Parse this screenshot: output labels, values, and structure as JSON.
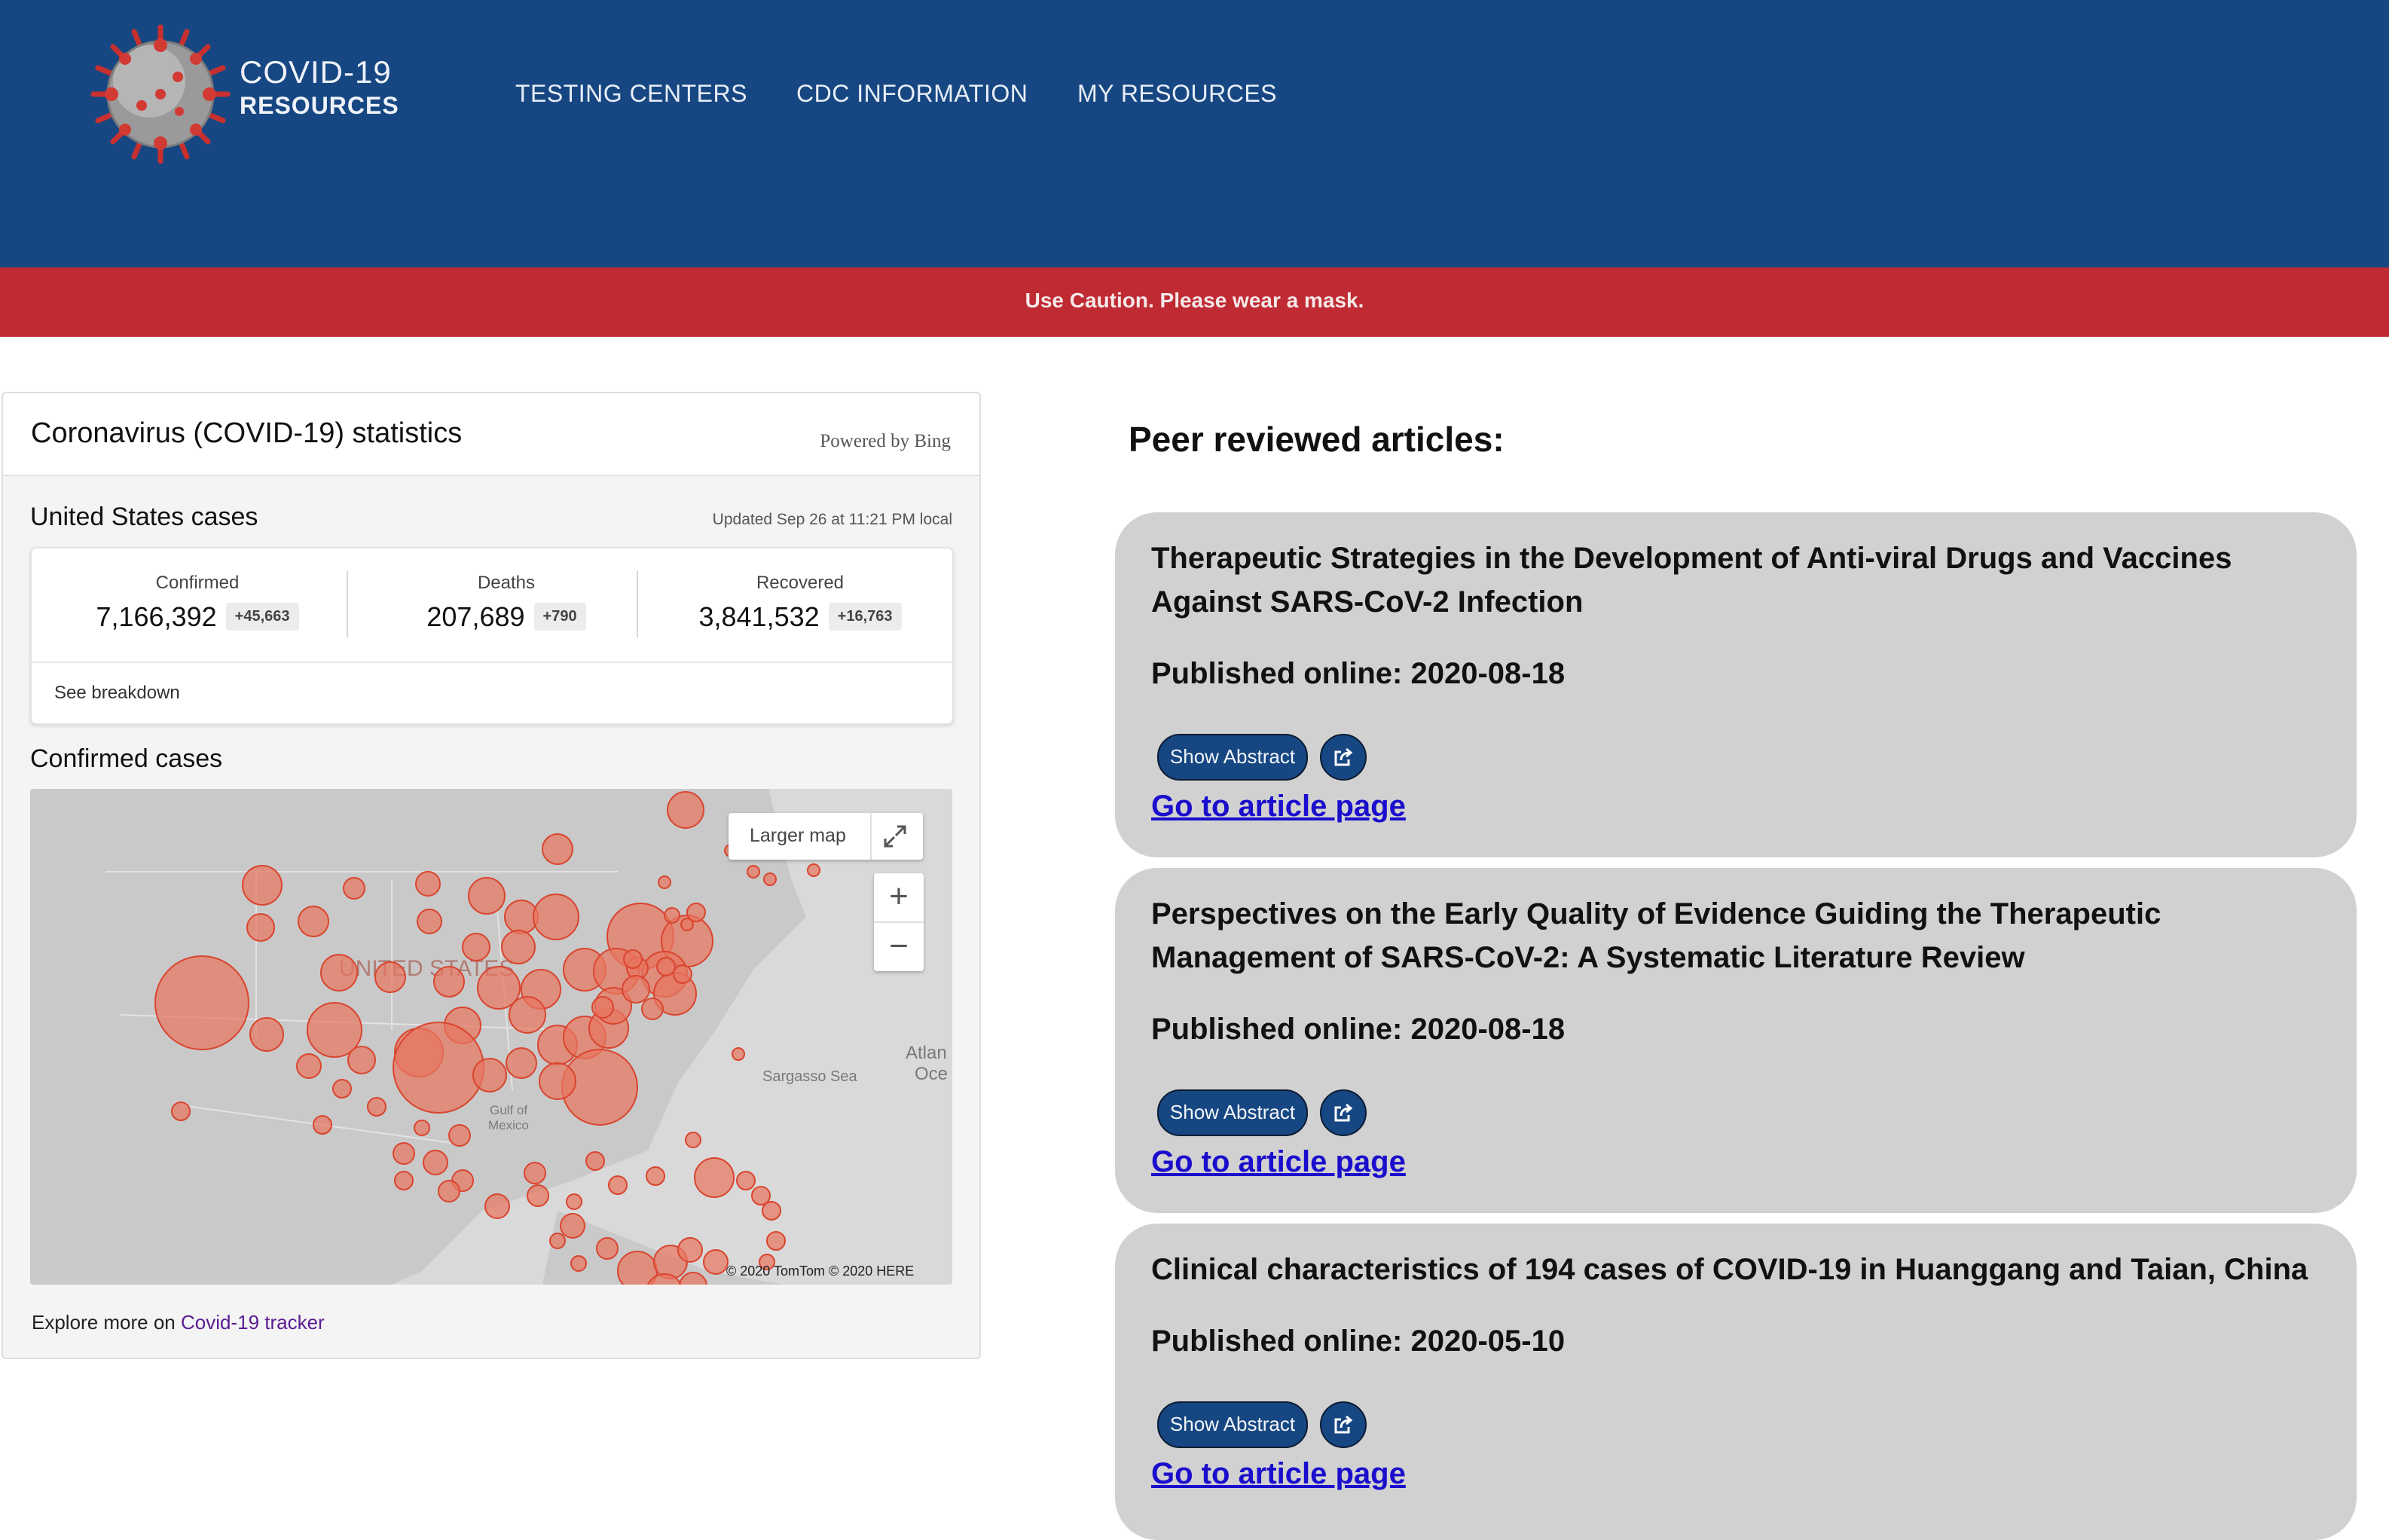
{
  "brand": {
    "line1": "COVID-19",
    "line2": "RESOURCES",
    "logo_icon": "coronavirus-icon"
  },
  "nav": {
    "items": [
      {
        "label": "TESTING CENTERS"
      },
      {
        "label": "CDC INFORMATION"
      },
      {
        "label": "MY RESOURCES"
      }
    ]
  },
  "banner": {
    "text": "Use Caution. Please wear a mask."
  },
  "colors": {
    "header": "#174782",
    "banner": "#bf2a33",
    "card": "#d1d1d1",
    "link": "#1a0dcc",
    "bubble": "#e8765f"
  },
  "stats": {
    "title": "Coronavirus (COVID-19) statistics",
    "powered_by": "Powered by Bing",
    "region_title": "United States cases",
    "updated": "Updated Sep 26 at 11:21 PM local",
    "confirmed": {
      "label": "Confirmed",
      "value": "7,166,392",
      "delta": "+45,663"
    },
    "deaths": {
      "label": "Deaths",
      "value": "207,689",
      "delta": "+790"
    },
    "recovered": {
      "label": "Recovered",
      "value": "3,841,532",
      "delta": "+16,763"
    },
    "breakdown_link": "See breakdown",
    "confirmed_cases_title": "Confirmed cases",
    "map": {
      "larger_map": "Larger map",
      "zoom_in": "+",
      "zoom_out": "−",
      "labels": {
        "country": "UNITED STATES",
        "sea": "Sargasso Sea",
        "gulf_1": "Gulf of",
        "gulf_2": "Mexico",
        "ocean_1": "Atlan",
        "ocean_2": "Oce"
      },
      "copyright": "© 2020 TomTom © 2020 HERE"
    },
    "explore_prefix": "Explore more on ",
    "explore_link": "Covid-19 tracker"
  },
  "articles_title": "Peer reviewed articles:",
  "articles": [
    {
      "title": "Therapeutic Strategies in the Development of Anti-viral Drugs and Vaccines Against SARS-CoV-2 Infection",
      "published": "Published online: 2020-08-18",
      "show_abstract": "Show Abstract",
      "link": "Go to article page"
    },
    {
      "title": "Perspectives on the Early Quality of Evidence Guiding the Therapeutic Management of SARS-CoV-2: A Systematic Literature Review",
      "published": "Published online: 2020-08-18",
      "show_abstract": "Show Abstract",
      "link": "Go to article page"
    },
    {
      "title": "Clinical characteristics of 194 cases of COVID-19 in Huanggang and Taian, China",
      "published": "Published online: 2020-05-10",
      "show_abstract": "Show Abstract",
      "link": "Go to article page"
    }
  ]
}
